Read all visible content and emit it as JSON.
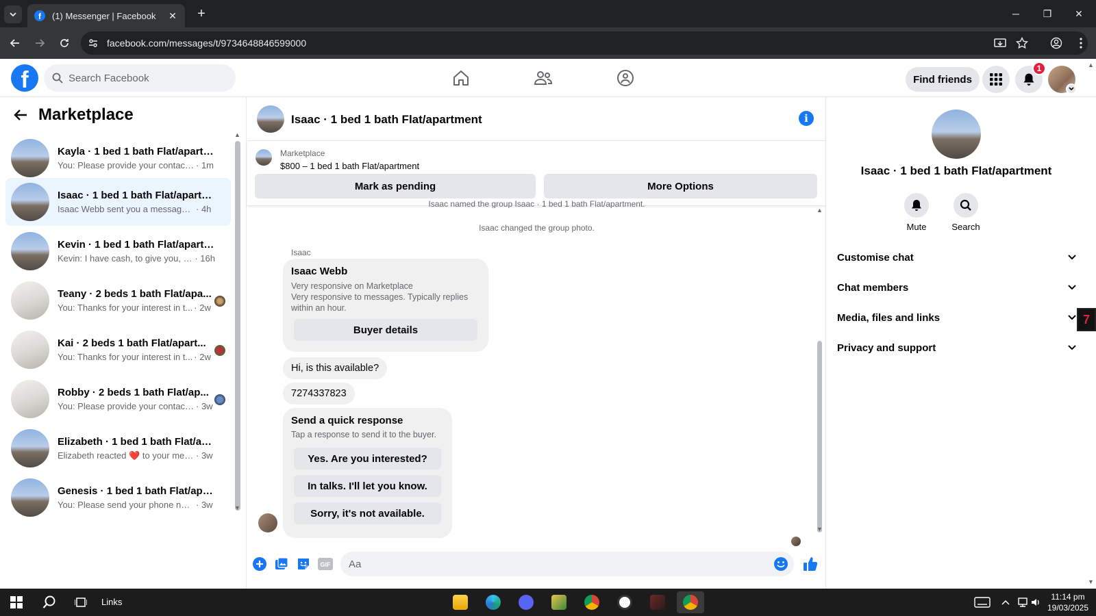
{
  "browser": {
    "tab_title": "(1) Messenger | Facebook",
    "url": "facebook.com/messages/t/9734648846599000"
  },
  "fb": {
    "logo_letter": "f",
    "search_placeholder": "Search Facebook",
    "find_friends": "Find friends",
    "notification_count": "1",
    "brand_color": "#1877f2"
  },
  "sidebar": {
    "title": "Marketplace",
    "conversations": [
      {
        "name": "Kayla · 1 bed 1 bath Flat/apartm...",
        "preview": "You: Please provide your contact n...",
        "time": "· 1m",
        "avatar": "city"
      },
      {
        "name": "Isaac · 1 bed 1 bath Flat/apartme...",
        "preview": "Isaac Webb sent you a message ab...",
        "time": "· 4h",
        "avatar": "city",
        "active": true
      },
      {
        "name": "Kevin · 1 bed 1 bath Flat/apartm...",
        "preview": "Kevin: I have cash, to give you, up...",
        "time": "· 16h",
        "avatar": "city"
      },
      {
        "name": "Teany · 2 beds 1 bath Flat/apa...",
        "preview": "You: Thanks for your interest in t...",
        "time": "· 2w",
        "avatar": "room"
      },
      {
        "name": "Kai · 2 beds 1 bath Flat/apart...",
        "preview": "You: Thanks for your interest in t...",
        "time": "· 2w",
        "avatar": "room"
      },
      {
        "name": "Robby · 2 beds 1 bath Flat/ap...",
        "preview": "You: Please provide your contact...",
        "time": "· 3w",
        "avatar": "room"
      },
      {
        "name": "Elizabeth · 1 bed 1 bath Flat/apar...",
        "preview": "Elizabeth reacted ❤️ to your mess...",
        "time": "· 3w",
        "avatar": "city"
      },
      {
        "name": "Genesis · 1 bed 1 bath Flat/apart...",
        "preview": "You: Please send your phone numb...",
        "time": "· 3w",
        "avatar": "city"
      }
    ]
  },
  "chat": {
    "title": "Isaac · 1 bed 1 bath Flat/apartment",
    "listing_category": "Marketplace",
    "listing_price_title": "$800 – 1 bed 1 bath Flat/apartment",
    "mark_pending": "Mark as pending",
    "more_options": "More Options",
    "sys_msg_1": "Isaac named the group Isaac · 1 bed 1 bath Flat/apartment.",
    "sys_msg_2": "Isaac changed the group photo.",
    "sender": "Isaac",
    "buyer_card": {
      "name": "Isaac Webb",
      "line1": "Very responsive on Marketplace",
      "line2": "Very responsive to messages. Typically replies within an hour.",
      "button": "Buyer details"
    },
    "messages": [
      "Hi, is this available?",
      "7274337823"
    ],
    "quick_response": {
      "title": "Send a quick response",
      "subtitle": "Tap a response to send it to the buyer.",
      "options": [
        "Yes. Are you interested?",
        "In talks. I'll let you know.",
        "Sorry, it's not available."
      ]
    },
    "composer_placeholder": "Aa"
  },
  "info_panel": {
    "name": "Isaac · 1 bed 1 bath Flat/apartment",
    "mute": "Mute",
    "search": "Search",
    "sections": [
      "Customise chat",
      "Chat members",
      "Media, files and links",
      "Privacy and support"
    ]
  },
  "taskbar": {
    "links_label": "Links",
    "time": "11:14 pm",
    "date": "19/03/2025"
  }
}
